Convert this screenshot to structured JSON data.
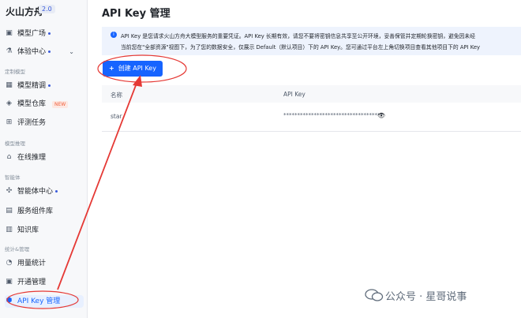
{
  "sidebar": {
    "brand": "火山方舟",
    "version": "2.0",
    "items": [
      {
        "label": "模型广场",
        "icon": "cube-icon"
      },
      {
        "label": "体验中心",
        "icon": "flask-icon"
      },
      {
        "section": "定制模型"
      },
      {
        "label": "模型精调",
        "icon": "tune-icon"
      },
      {
        "label": "模型仓库",
        "icon": "repo-icon",
        "badge": "NEW"
      },
      {
        "label": "评测任务",
        "icon": "evaluate-icon"
      },
      {
        "section": "模型推理"
      },
      {
        "label": "在线推理",
        "icon": "inference-icon"
      },
      {
        "section": "智能体"
      },
      {
        "label": "智能体中心",
        "icon": "agent-icon"
      },
      {
        "label": "服务组件库",
        "icon": "components-icon"
      },
      {
        "label": "知识库",
        "icon": "knowledge-icon"
      },
      {
        "section": "统计&管理"
      },
      {
        "label": "用量统计",
        "icon": "usage-icon"
      },
      {
        "label": "开通管理",
        "icon": "activation-icon"
      },
      {
        "label": "API Key 管理",
        "icon": "key-icon",
        "active": true
      }
    ]
  },
  "main": {
    "title": "API Key 管理",
    "notice_line1": "API Key 是您请求火山方舟大模型服务的重要凭证。API Key 长期有效，请您不要将密钥信息共享至公开环境，妥善保管并定期轮换密钥，避免因未经",
    "notice_line2": "当前您在\"全部资源\"视图下，为了您的数据安全，仅展示 Default（默认项目）下的 API Key。您可通过平台左上角切换项目查看其他项目下的 API Key",
    "create_button": "创建 API Key",
    "table": {
      "headers": [
        "名称",
        "API Key"
      ],
      "rows": [
        {
          "name": "star",
          "key": "************************************"
        }
      ]
    }
  },
  "watermark": "公众号 · 星哥说事",
  "colors": {
    "accent": "#1664ff",
    "annotation": "#e53935"
  }
}
